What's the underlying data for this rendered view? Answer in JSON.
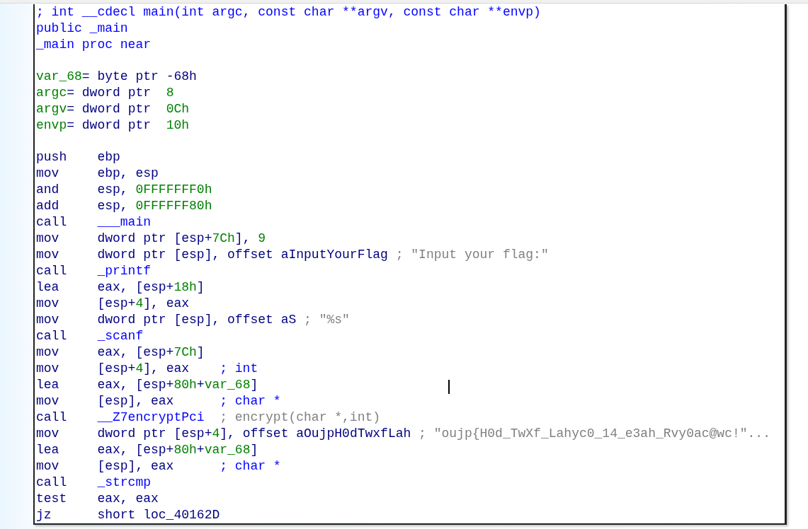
{
  "listing": [
    {
      "kind": "directive",
      "text": "; int __cdecl main(int argc, const char **argv, const char **envp)"
    },
    {
      "kind": "directive",
      "text": "public _main"
    },
    {
      "kind": "directive",
      "text": "_main proc near"
    },
    {
      "kind": "blank"
    },
    {
      "kind": "var",
      "parts": [
        {
          "kind": "name",
          "text": "var_68"
        },
        {
          "kind": "plain",
          "text": "= byte ptr -68h"
        }
      ]
    },
    {
      "kind": "var",
      "parts": [
        {
          "kind": "name",
          "text": "argc"
        },
        {
          "kind": "plain",
          "text": "= dword ptr  "
        },
        {
          "kind": "number",
          "text": "8"
        }
      ]
    },
    {
      "kind": "var",
      "parts": [
        {
          "kind": "name",
          "text": "argv"
        },
        {
          "kind": "plain",
          "text": "= dword ptr  "
        },
        {
          "kind": "number",
          "text": "0Ch"
        }
      ]
    },
    {
      "kind": "var",
      "parts": [
        {
          "kind": "name",
          "text": "envp"
        },
        {
          "kind": "plain",
          "text": "= dword ptr  "
        },
        {
          "kind": "number",
          "text": "10h"
        }
      ]
    },
    {
      "kind": "blank"
    },
    {
      "kind": "instr",
      "mnemonic": "push",
      "operand": [
        {
          "kind": "plain",
          "text": "ebp"
        }
      ]
    },
    {
      "kind": "instr",
      "mnemonic": "mov",
      "operand": [
        {
          "kind": "plain",
          "text": "ebp, esp"
        }
      ]
    },
    {
      "kind": "instr",
      "mnemonic": "and",
      "operand": [
        {
          "kind": "plain",
          "text": "esp, "
        },
        {
          "kind": "number",
          "text": "0FFFFFFF0h"
        }
      ]
    },
    {
      "kind": "instr",
      "mnemonic": "add",
      "operand": [
        {
          "kind": "plain",
          "text": "esp, "
        },
        {
          "kind": "number",
          "text": "0FFFFFF80h"
        }
      ]
    },
    {
      "kind": "instr",
      "mnemonic": "call",
      "operand": [
        {
          "kind": "function",
          "text": "___main"
        }
      ]
    },
    {
      "kind": "instr",
      "mnemonic": "mov",
      "operand": [
        {
          "kind": "plain",
          "text": "dword ptr [esp+"
        },
        {
          "kind": "number",
          "text": "7Ch"
        },
        {
          "kind": "plain",
          "text": "], "
        },
        {
          "kind": "number",
          "text": "9"
        }
      ]
    },
    {
      "kind": "instr",
      "mnemonic": "mov",
      "operand": [
        {
          "kind": "plain",
          "text": "dword ptr [esp], offset aInputYourFlag"
        }
      ],
      "comment": {
        "kind": "auto",
        "text": "; \"Input your flag:\""
      }
    },
    {
      "kind": "instr",
      "mnemonic": "call",
      "operand": [
        {
          "kind": "function",
          "text": "_printf"
        }
      ]
    },
    {
      "kind": "instr",
      "mnemonic": "lea",
      "operand": [
        {
          "kind": "plain",
          "text": "eax, [esp+"
        },
        {
          "kind": "number",
          "text": "18h"
        },
        {
          "kind": "plain",
          "text": "]"
        }
      ]
    },
    {
      "kind": "instr",
      "mnemonic": "mov",
      "operand": [
        {
          "kind": "plain",
          "text": "[esp+"
        },
        {
          "kind": "number",
          "text": "4"
        },
        {
          "kind": "plain",
          "text": "], eax"
        }
      ]
    },
    {
      "kind": "instr",
      "mnemonic": "mov",
      "operand": [
        {
          "kind": "plain",
          "text": "dword ptr [esp], offset aS"
        }
      ],
      "comment": {
        "kind": "auto",
        "text": "; \"%s\""
      }
    },
    {
      "kind": "instr",
      "mnemonic": "call",
      "operand": [
        {
          "kind": "function",
          "text": "_scanf"
        }
      ]
    },
    {
      "kind": "instr",
      "mnemonic": "mov",
      "operand": [
        {
          "kind": "plain",
          "text": "eax, [esp+"
        },
        {
          "kind": "number",
          "text": "7Ch"
        },
        {
          "kind": "plain",
          "text": "]"
        }
      ]
    },
    {
      "kind": "instr",
      "mnemonic": "mov",
      "operand": [
        {
          "kind": "plain",
          "text": "[esp+"
        },
        {
          "kind": "number",
          "text": "4"
        },
        {
          "kind": "plain",
          "text": "], eax"
        }
      ],
      "comment": {
        "kind": "type",
        "text": "; int"
      }
    },
    {
      "kind": "instr",
      "mnemonic": "lea",
      "operand": [
        {
          "kind": "plain",
          "text": "eax, [esp+"
        },
        {
          "kind": "number",
          "text": "80h"
        },
        {
          "kind": "plain",
          "text": "+"
        },
        {
          "kind": "name",
          "text": "var_68"
        },
        {
          "kind": "plain",
          "text": "]"
        }
      ]
    },
    {
      "kind": "instr",
      "mnemonic": "mov",
      "operand": [
        {
          "kind": "plain",
          "text": "[esp], eax"
        }
      ],
      "comment": {
        "kind": "type",
        "text": "; char *"
      }
    },
    {
      "kind": "instr",
      "mnemonic": "call",
      "operand": [
        {
          "kind": "function",
          "text": "__Z7encryptPci"
        }
      ],
      "comment": {
        "kind": "auto",
        "text": "; encrypt(char *,int)"
      }
    },
    {
      "kind": "instr",
      "mnemonic": "mov",
      "operand": [
        {
          "kind": "plain",
          "text": "dword ptr [esp+"
        },
        {
          "kind": "number",
          "text": "4"
        },
        {
          "kind": "plain",
          "text": "], offset aOujpH0dTwxfLah"
        }
      ],
      "comment": {
        "kind": "auto",
        "text": "; \"oujp{H0d_TwXf_Lahyc0_14_e3ah_Rvy0ac@wc!\"..."
      }
    },
    {
      "kind": "instr",
      "mnemonic": "lea",
      "operand": [
        {
          "kind": "plain",
          "text": "eax, [esp+"
        },
        {
          "kind": "number",
          "text": "80h"
        },
        {
          "kind": "plain",
          "text": "+"
        },
        {
          "kind": "name",
          "text": "var_68"
        },
        {
          "kind": "plain",
          "text": "]"
        }
      ]
    },
    {
      "kind": "instr",
      "mnemonic": "mov",
      "operand": [
        {
          "kind": "plain",
          "text": "[esp], eax"
        }
      ],
      "comment": {
        "kind": "type",
        "text": "; char *"
      }
    },
    {
      "kind": "instr",
      "mnemonic": "call",
      "operand": [
        {
          "kind": "function",
          "text": "_strcmp"
        }
      ]
    },
    {
      "kind": "instr",
      "mnemonic": "test",
      "operand": [
        {
          "kind": "plain",
          "text": "eax, eax"
        }
      ]
    },
    {
      "kind": "instr",
      "mnemonic": "jz",
      "operand": [
        {
          "kind": "plain",
          "text": "short loc_40162D"
        }
      ]
    }
  ]
}
